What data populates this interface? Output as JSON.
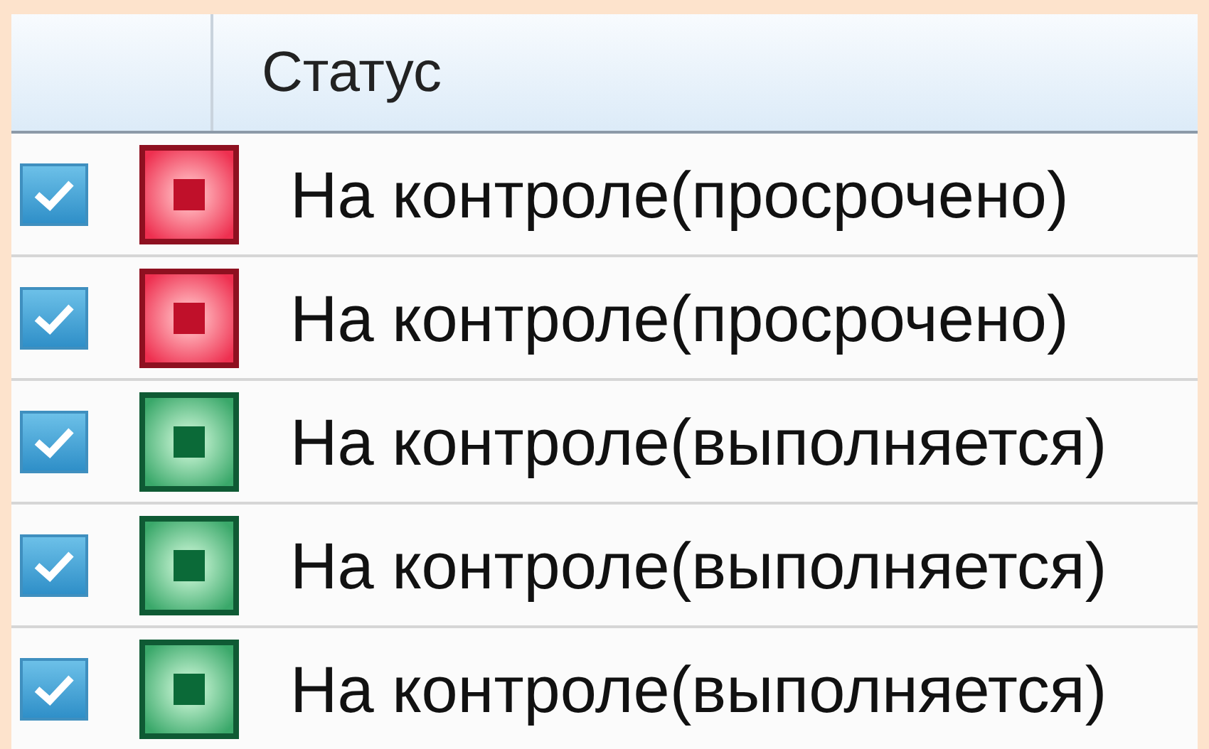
{
  "table": {
    "columns": [
      {
        "label": "Статус"
      }
    ],
    "rows": [
      {
        "checked": true,
        "status": {
          "kind": "overdue",
          "label": "На контроле(просрочено)"
        }
      },
      {
        "checked": true,
        "status": {
          "kind": "overdue",
          "label": "На контроле(просрочено)"
        }
      },
      {
        "checked": true,
        "status": {
          "kind": "running",
          "label": "На контроле(выполняется)"
        }
      },
      {
        "checked": true,
        "status": {
          "kind": "running",
          "label": "На контроле(выполняется)"
        }
      },
      {
        "checked": true,
        "status": {
          "kind": "running",
          "label": "На контроле(выполняется)"
        }
      }
    ]
  }
}
